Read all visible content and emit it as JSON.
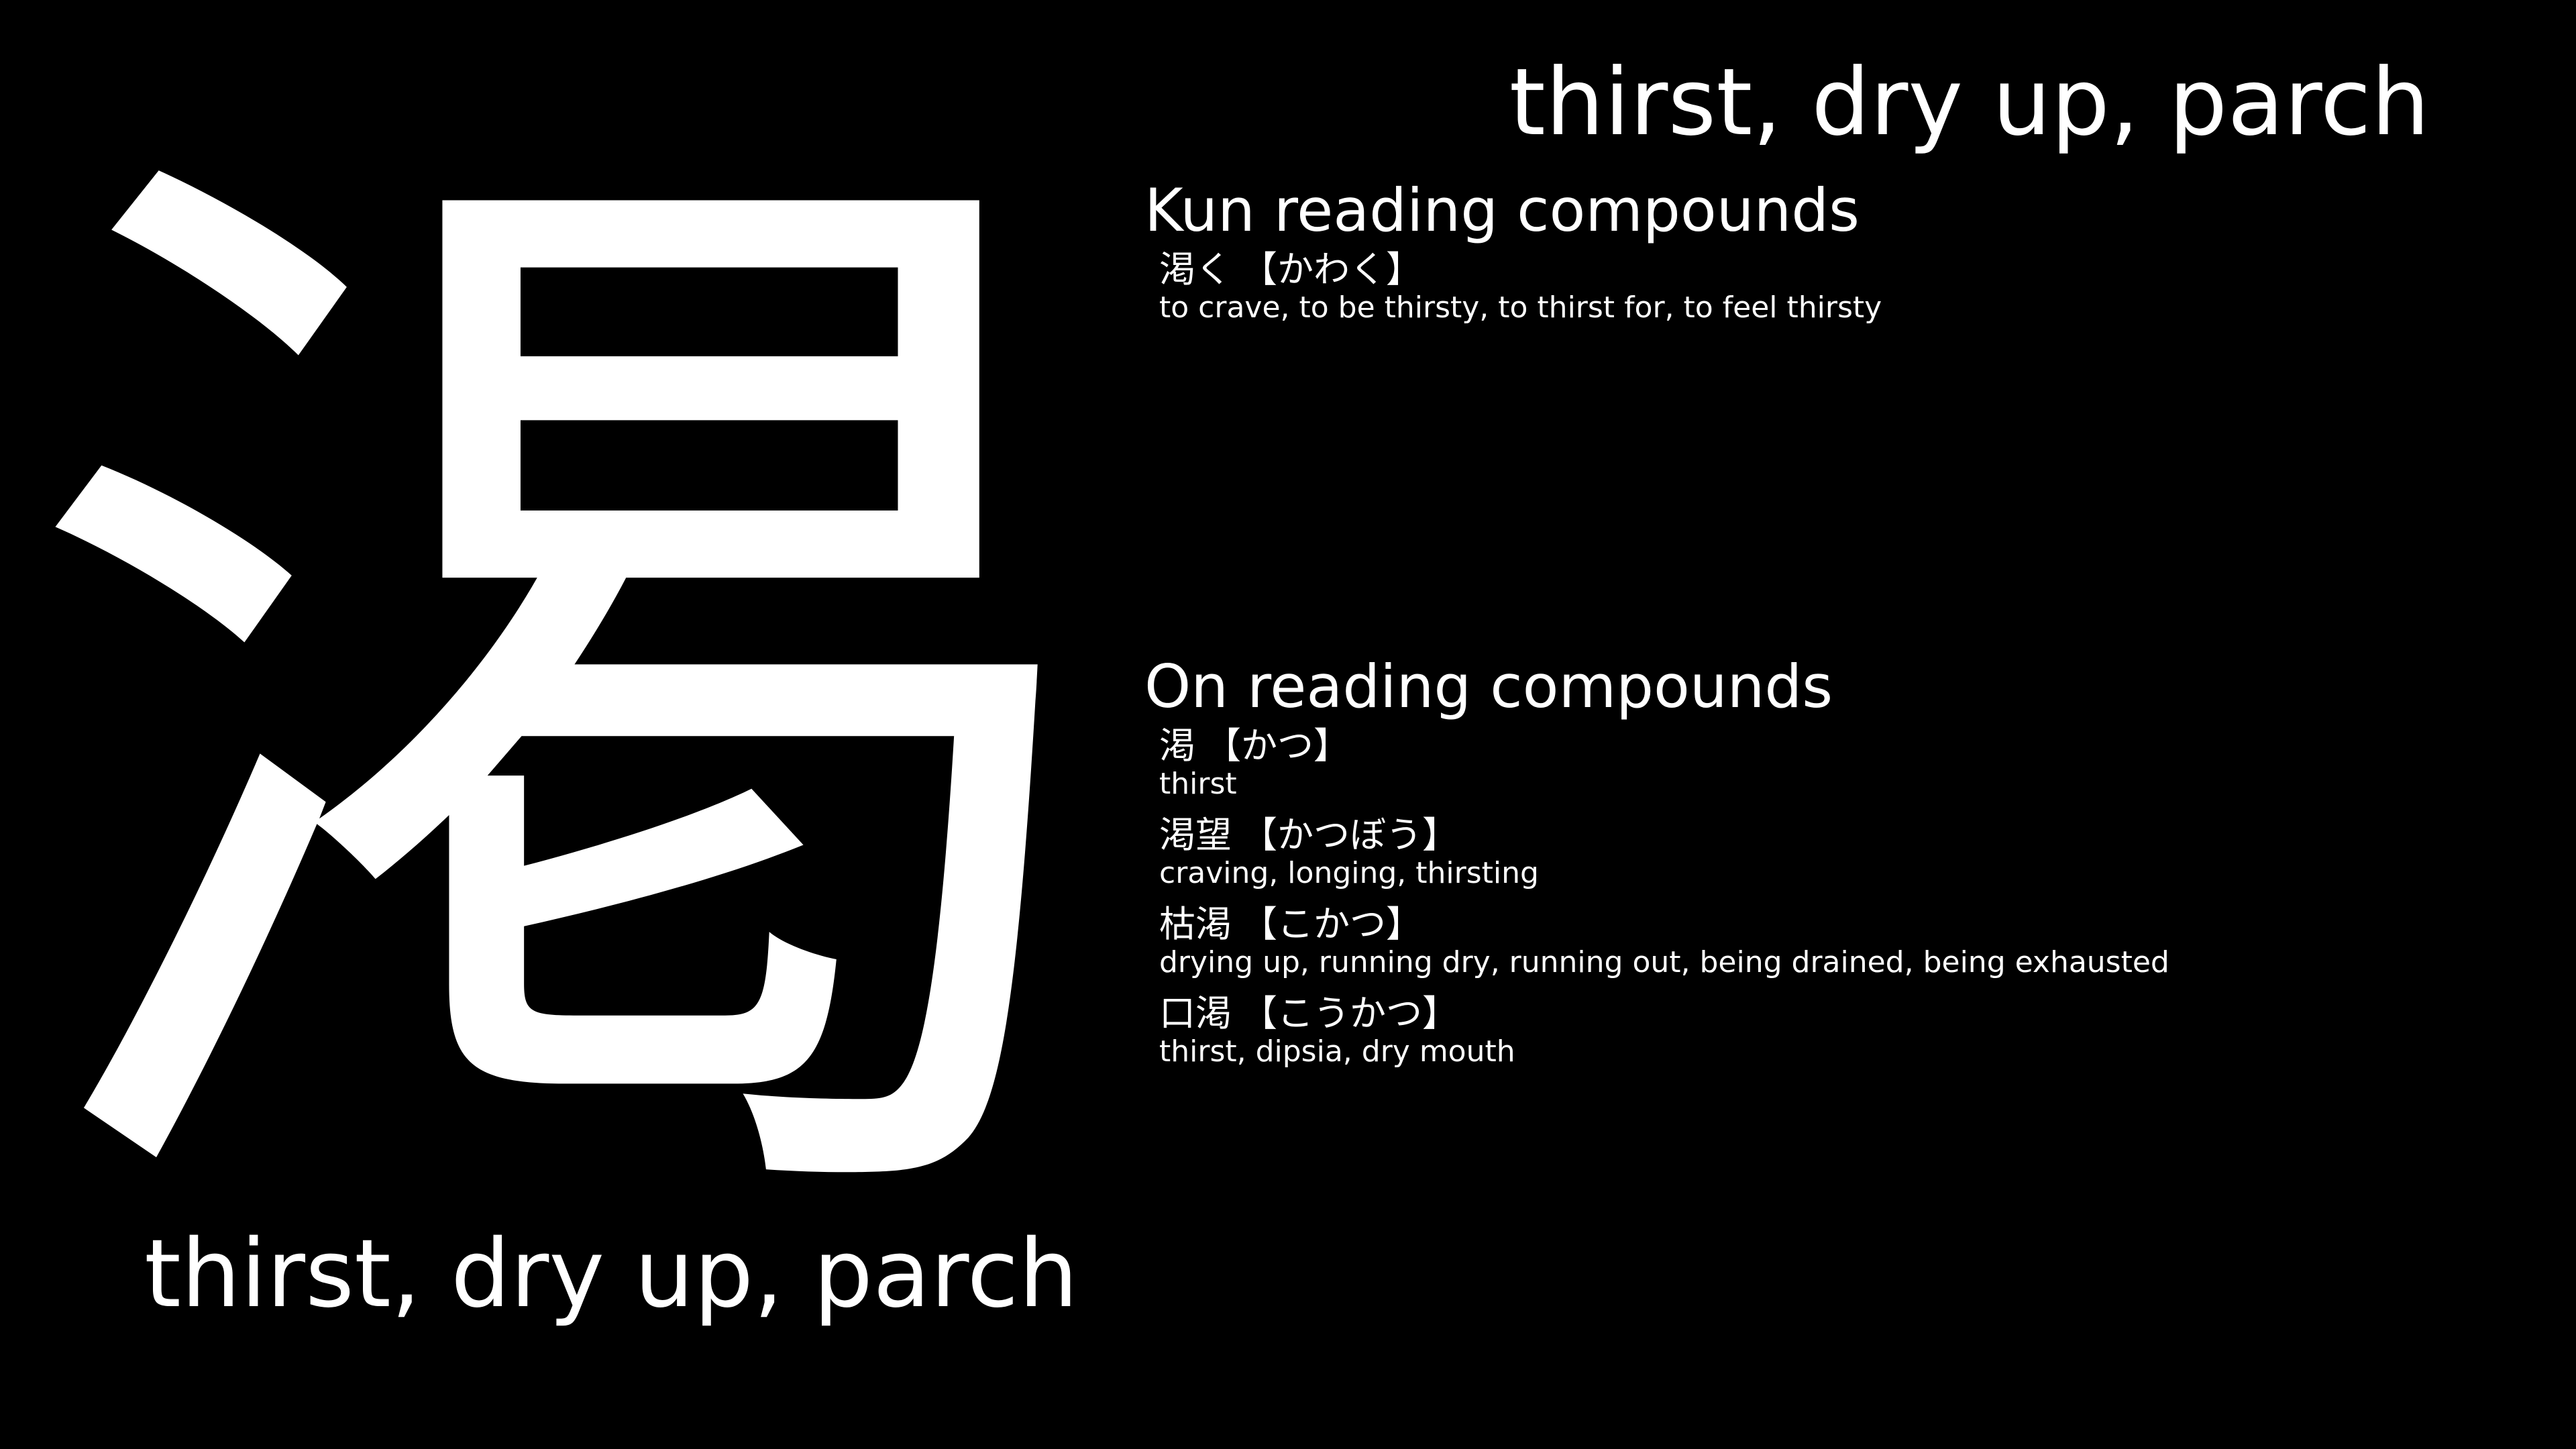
{
  "kanji": "渇",
  "meaning": "thirst, dry up, parch",
  "kun": {
    "heading": "Kun reading compounds",
    "entries": [
      {
        "word": "渇く",
        "reading": "【かわく】",
        "gloss": "to crave, to be thirsty, to thirst for, to feel thirsty"
      }
    ]
  },
  "on": {
    "heading": "On reading compounds",
    "entries": [
      {
        "word": "渇",
        "reading": "【かつ】",
        "gloss": "thirst"
      },
      {
        "word": "渇望",
        "reading": "【かつぼう】",
        "gloss": "craving, longing, thirsting"
      },
      {
        "word": "枯渇",
        "reading": "【こかつ】",
        "gloss": "drying up, running dry, running out, being drained, being exhausted"
      },
      {
        "word": "口渇",
        "reading": "【こうかつ】",
        "gloss": "thirst, dipsia, dry mouth"
      }
    ]
  },
  "colors": {
    "background": "#000000",
    "text": "#ffffff"
  }
}
